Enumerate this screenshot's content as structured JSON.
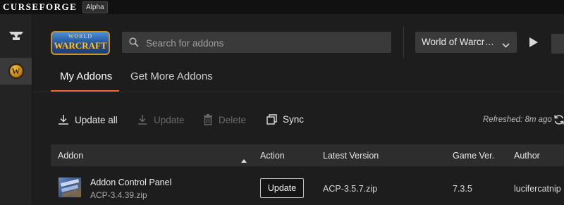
{
  "titlebar": {
    "brand": "CURSEFORGE",
    "badge": "Alpha"
  },
  "rail": {
    "items": [
      "anvil-icon",
      "world-of-warcraft-icon"
    ],
    "active_index": 1
  },
  "header": {
    "game_logo_line1": "WORLD",
    "game_logo_line2": "WARCRAFT",
    "search_placeholder": "Search for addons",
    "game_select_value": "World of Warcr…"
  },
  "tabs": [
    {
      "label": "My Addons",
      "active": true
    },
    {
      "label": "Get More Addons",
      "active": false
    }
  ],
  "toolbar": {
    "update_all": "Update all",
    "update": "Update",
    "delete": "Delete",
    "sync": "Sync",
    "refreshed": "Refreshed: 8m ago"
  },
  "table": {
    "columns": [
      "Addon",
      "Action",
      "Latest Version",
      "Game Ver.",
      "Author"
    ],
    "sort_column": "Addon",
    "rows": [
      {
        "name": "Addon Control Panel",
        "file": "ACP-3.4.39.zip",
        "action": "Update",
        "latest_version": "ACP-3.5.7.zip",
        "game_version": "7.3.5",
        "author": "lucifercatnip"
      }
    ]
  },
  "colors": {
    "accent": "#f16436",
    "background": "#1d1d1d",
    "titlebar": "#111111",
    "input": "#3a3a3a",
    "table_header": "#2d2d2d"
  }
}
